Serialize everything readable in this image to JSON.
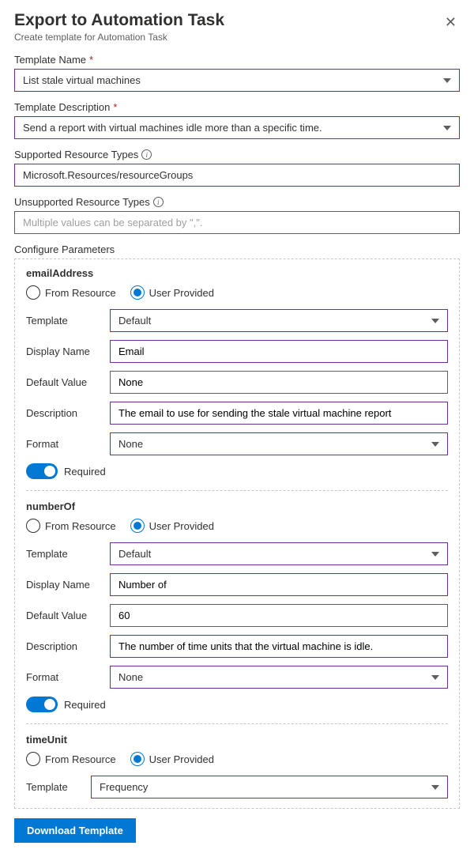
{
  "header": {
    "title": "Export to Automation Task",
    "subtitle": "Create template for Automation Task"
  },
  "fields": {
    "templateName": {
      "label": "Template Name",
      "value": "List stale virtual machines"
    },
    "templateDescription": {
      "label": "Template Description",
      "value": "Send a report with virtual machines idle more than a specific time."
    },
    "supportedResourceTypes": {
      "label": "Supported Resource Types",
      "value": "Microsoft.Resources/resourceGroups"
    },
    "unsupportedResourceTypes": {
      "label": "Unsupported Resource Types",
      "placeholder": "Multiple values can be separated by \",\"."
    }
  },
  "configureParametersLabel": "Configure Parameters",
  "radioOptions": {
    "fromResource": "From Resource",
    "userProvided": "User Provided"
  },
  "paramLabels": {
    "template": "Template",
    "displayName": "Display Name",
    "defaultValue": "Default Value",
    "description": "Description",
    "format": "Format",
    "required": "Required"
  },
  "params": {
    "emailAddress": {
      "name": "emailAddress",
      "template": "Default",
      "displayName": "Email",
      "defaultValue": "None",
      "description": "The email to use for sending the stale virtual machine report",
      "format": "None"
    },
    "numberOf": {
      "name": "numberOf",
      "template": "Default",
      "displayName": "Number of",
      "defaultValue": "60",
      "description": "The number of time units that the virtual machine is idle.",
      "format": "None"
    },
    "timeUnit": {
      "name": "timeUnit",
      "template": "Frequency"
    }
  },
  "downloadButton": "Download Template"
}
